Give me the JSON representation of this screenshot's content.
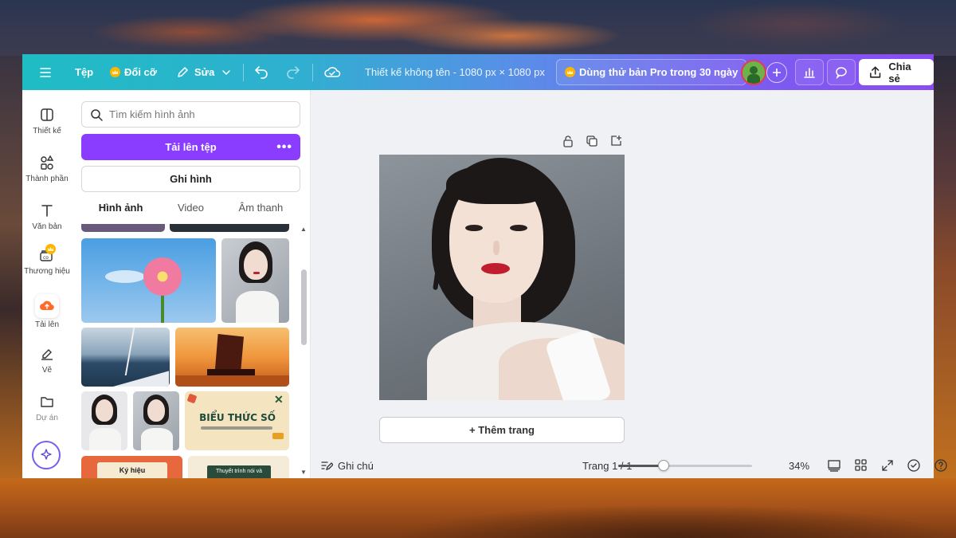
{
  "topbar": {
    "menu_icon": "hamburger-icon",
    "file_label": "Tệp",
    "resize_label": "Đổi cỡ",
    "edit_label": "Sửa",
    "design_title": "Thiết kế không tên - 1080 px × 1080 px",
    "pro_trial_label": "Dùng thử bản Pro trong 30 ngày",
    "share_label": "Chia sẻ"
  },
  "sidebar": {
    "items": [
      {
        "label": "Thiết kế",
        "icon": "template-icon"
      },
      {
        "label": "Thành phần",
        "icon": "elements-icon"
      },
      {
        "label": "Văn bản",
        "icon": "text-icon"
      },
      {
        "label": "Thương hiệu",
        "icon": "brand-icon"
      },
      {
        "label": "Tải lên",
        "icon": "upload-cloud-icon"
      },
      {
        "label": "Vẽ",
        "icon": "draw-icon"
      },
      {
        "label": "Dự án",
        "icon": "folder-icon"
      }
    ],
    "active": "Tải lên"
  },
  "panel": {
    "search_placeholder": "Tìm kiếm hình ảnh",
    "upload_label": "Tải lên tệp",
    "record_label": "Ghi hình",
    "tabs": [
      "Hình ảnh",
      "Video",
      "Âm thanh"
    ],
    "active_tab": "Hình ảnh",
    "thumb_text": {
      "biu_title": "BIỂU THỨC SỐ",
      "orange_title": "Ký hiệu",
      "green_title": "Thuyết trình nói và"
    }
  },
  "canvas": {
    "add_page_label": "+ Thêm trang"
  },
  "bottombar": {
    "notes_label": "Ghi chú",
    "page_indicator": "Trang 1 / 1",
    "zoom_label": "34%",
    "zoom_value": 0.34
  },
  "colors": {
    "brand_purple": "#8b3dff",
    "topbar_start": "#1fbcc4",
    "topbar_end": "#8a4cf2"
  }
}
